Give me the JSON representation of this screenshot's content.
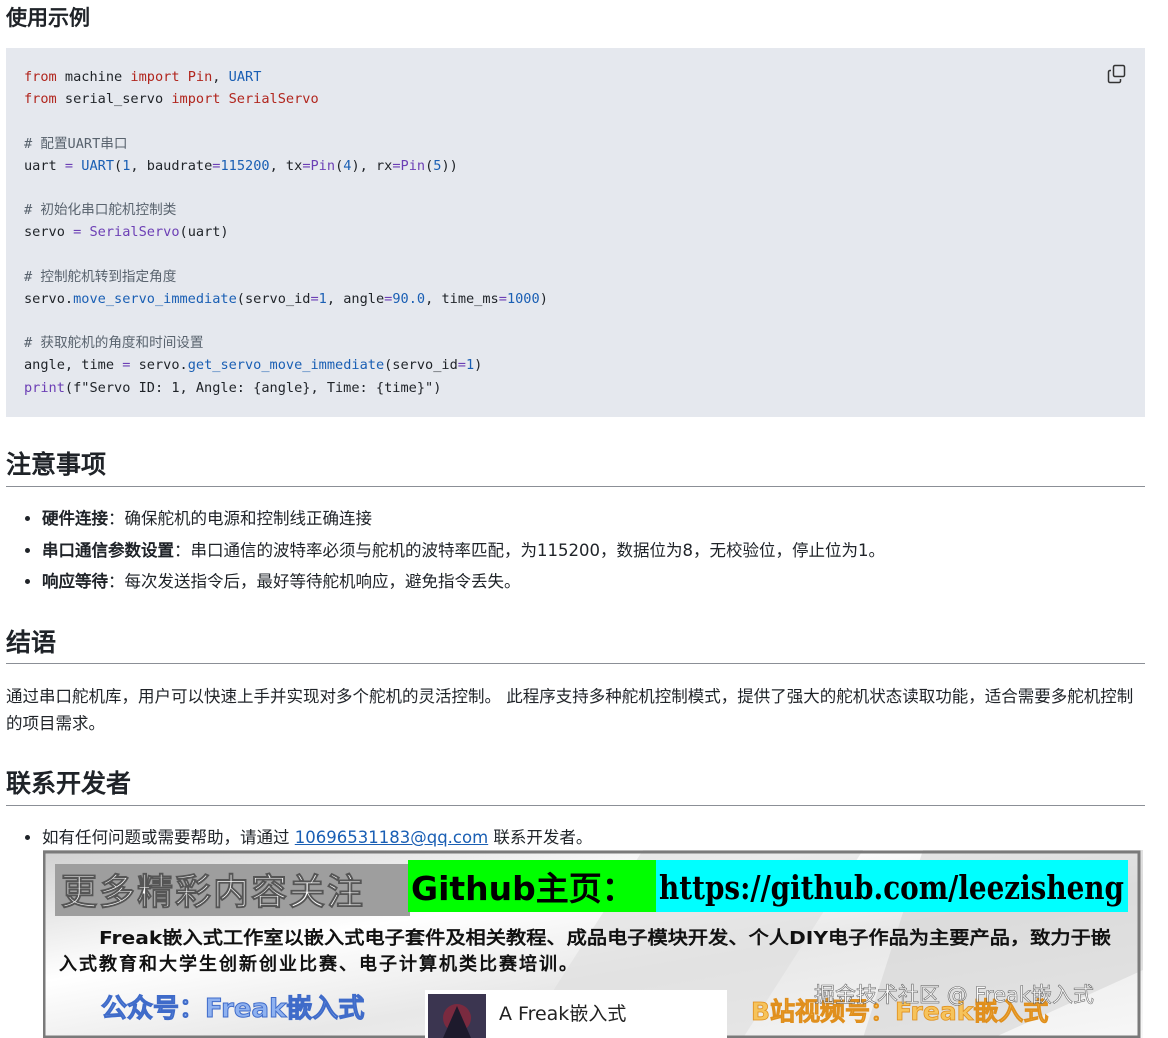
{
  "usage": {
    "heading": "使用示例"
  },
  "code": {
    "l1": {
      "a": "from",
      "b": " machine ",
      "c": "import",
      "d": " Pin",
      "e": ", ",
      "f": "UART"
    },
    "l2": {
      "a": "from",
      "b": " serial_servo ",
      "c": "import",
      "d": " SerialServo"
    },
    "l4": "# 配置UART串口",
    "l5": {
      "a": "uart ",
      "b": "=",
      "c": " ",
      "d": "UART",
      "e": "(",
      "f": "1",
      "g": ", baudrate",
      "h": "=",
      "i": "115200",
      "j": ", tx",
      "k": "=",
      "l": "Pin",
      "m": "(",
      "n": "4",
      "o": "), rx",
      "p": "=",
      "q": "Pin",
      "r": "(",
      "s": "5",
      "t": "))"
    },
    "l7": "# 初始化串口舵机控制类",
    "l8": {
      "a": "servo ",
      "b": "=",
      "c": " ",
      "d": "SerialServo",
      "e": "(uart)"
    },
    "l10": "# 控制舵机转到指定角度",
    "l11": {
      "a": "servo.",
      "b": "move_servo_immediate",
      "c": "(servo_id",
      "d": "=",
      "e": "1",
      "f": ", angle",
      "g": "=",
      "h": "90.0",
      "i": ", time_ms",
      "j": "=",
      "k": "1000",
      "l": ")"
    },
    "l13": "# 获取舵机的角度和时间设置",
    "l14": {
      "a": "angle, time ",
      "b": "=",
      "c": " servo.",
      "d": "get_servo_move_immediate",
      "e": "(servo_id",
      "f": "=",
      "g": "1",
      "h": ")"
    },
    "l15": {
      "a": "print",
      "b": "(f\"Servo ID: 1, Angle: {angle}, Time: {time}\")"
    }
  },
  "notes": {
    "heading": "注意事项",
    "items": [
      {
        "term": "硬件连接",
        "text": "：确保舵机的电源和控制线正确连接"
      },
      {
        "term": "串口通信参数设置",
        "text": "：串口通信的波特率必须与舵机的波特率匹配，为115200，数据位为8，无校验位，停止位为1。"
      },
      {
        "term": "响应等待",
        "text": "：每次发送指令后，最好等待舵机响应，避免指令丢失。"
      }
    ]
  },
  "conclusion": {
    "heading": "结语",
    "text": "通过串口舵机库，用户可以快速上手并实现对多个舵机的灵活控制。 此程序支持多种舵机控制模式，提供了强大的舵机状态读取功能，适合需要多舵机控制的项目需求。"
  },
  "contact": {
    "heading": "联系开发者",
    "prefix": "如有任何问题或需要帮助，请通过 ",
    "email": "10696531183@qq.com",
    "suffix": " 联系开发者。"
  },
  "banner": {
    "follow": "更多精彩内容关注",
    "github_label": "Github主页：",
    "github_url": "https://github.com/leezisheng",
    "desc_line1": "Freak嵌入式工作室以嵌入式电子套件及相关教程、成品电子模块开发、个人DIY电子作品为主要产品，致力于嵌",
    "desc_line2": "入式教育和大学生创新创业比赛、电子计算机类比赛培训。",
    "wechat": "公众号：Freak嵌入式",
    "card_name": "A Freak嵌入式",
    "bilibili": "B站视频号：Freak嵌入式",
    "watermark": "掘金技术社区 @ Freak嵌入式",
    "colors": {
      "green": "#00ff00",
      "cyan": "#00ffff",
      "blue_text": "#6c8fe0",
      "orange_text": "#f3b33d"
    }
  }
}
